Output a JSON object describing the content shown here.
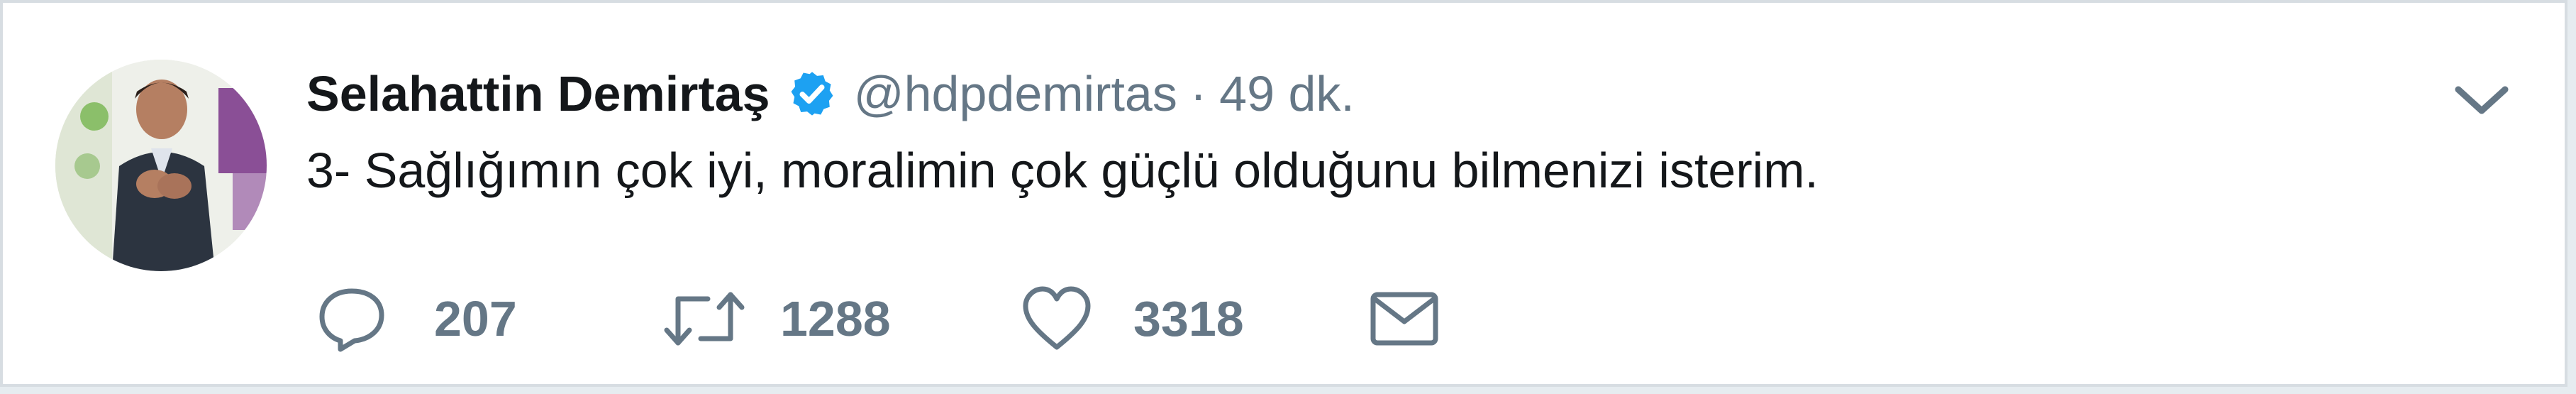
{
  "tweet": {
    "author_name": "Selahattin Demirtaş",
    "handle": "@hdpdemirtas",
    "separator": "·",
    "time": "49 dk.",
    "text": "3- Sağlığımın çok iyi, moralimin çok güçlü olduğunu bilmenizi isterim.",
    "actions": {
      "reply_count": "207",
      "retweet_count": "1288",
      "like_count": "3318"
    },
    "colors": {
      "verified_badge": "#1da1f2",
      "text": "#14171a",
      "muted": "#657786"
    },
    "icons": [
      "verified-icon",
      "chevron-down-icon",
      "reply-icon",
      "retweet-icon",
      "like-icon",
      "message-icon"
    ]
  }
}
